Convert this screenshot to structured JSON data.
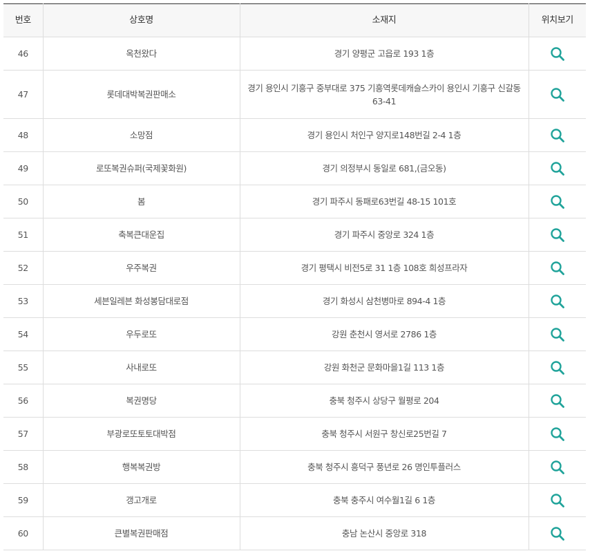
{
  "colors": {
    "accent": "#20a39a",
    "header_bg": "#f7f7f7",
    "border": "#dddddd",
    "top_border": "#333333"
  },
  "table": {
    "headers": {
      "no": "번호",
      "name": "상호명",
      "address": "소재지",
      "map": "위치보기"
    },
    "map_icon": "search-icon",
    "rows": [
      {
        "no": "46",
        "name": "옥천왔다",
        "address": "경기 양평군 고읍로 193 1층"
      },
      {
        "no": "47",
        "name": "롯데대박복권판매소",
        "address": "경기 용인시 기흥구 중부대로 375 기흥역롯데캐슬스카이 용인시 기흥구 신갈동 63-41"
      },
      {
        "no": "48",
        "name": "소망점",
        "address": "경기 용인시 처인구 양지로148번길 2-4 1층"
      },
      {
        "no": "49",
        "name": "로또복권슈퍼(국제꽃화원)",
        "address": "경기 의정부시 동일로 681,(금오동)"
      },
      {
        "no": "50",
        "name": "봄",
        "address": "경기 파주시 동패로63번길 48-15 101호"
      },
      {
        "no": "51",
        "name": "축복큰대운집",
        "address": "경기 파주시 중앙로 324 1층"
      },
      {
        "no": "52",
        "name": "우주복권",
        "address": "경기 평택시 비전5로 31 1층 108호 희성프라자"
      },
      {
        "no": "53",
        "name": "세븐일레븐 화성봉담대로점",
        "address": "경기 화성시 삼천병마로 894-4 1층"
      },
      {
        "no": "54",
        "name": "우두로또",
        "address": "강원 춘천시 영서로 2786 1층"
      },
      {
        "no": "55",
        "name": "사내로또",
        "address": "강원 화천군 문화마을1길 113 1층"
      },
      {
        "no": "56",
        "name": "복권명당",
        "address": "충북 청주시 상당구 월평로 204"
      },
      {
        "no": "57",
        "name": "부광로또토토대박점",
        "address": "충북 청주시 서원구 창신로25번길 7"
      },
      {
        "no": "58",
        "name": "행복복권방",
        "address": "충북 청주시 흥덕구 풍년로 26 명인투플러스"
      },
      {
        "no": "59",
        "name": "갱고개로",
        "address": "충북 충주시 여수월1길 6 1층"
      },
      {
        "no": "60",
        "name": "큰별복권판매점",
        "address": "충남 논산시 중앙로 318"
      }
    ]
  }
}
